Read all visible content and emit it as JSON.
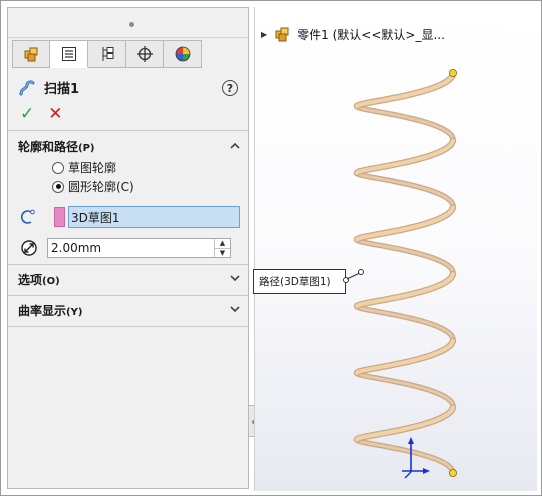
{
  "property_manager": {
    "tabs": [
      {
        "icon": "feature-manager-icon"
      },
      {
        "icon": "property-manager-icon"
      },
      {
        "icon": "configuration-manager-icon"
      },
      {
        "icon": "dimxpert-manager-icon"
      },
      {
        "icon": "display-manager-icon"
      }
    ],
    "active_tab": 1,
    "feature_title": "扫描1",
    "help_label": "?",
    "ok_symbol": "✓",
    "cancel_symbol": "✕",
    "sections": {
      "profile_path": {
        "title": "轮廓和路径",
        "suffix": "(P)",
        "expanded": true,
        "options": [
          {
            "label": "草图轮廓",
            "checked": false
          },
          {
            "label": "圆形轮廓(C)",
            "checked": true
          }
        ],
        "path_value": "3D草图1",
        "diameter_value": "2.00mm"
      },
      "options": {
        "title": "选项",
        "suffix": "(O)",
        "expanded": false
      },
      "curvature": {
        "title": "曲率显示",
        "suffix": "(Y)",
        "expanded": false
      }
    }
  },
  "graphics": {
    "tree_item": "零件1  (默认<<默认>_显...",
    "callout_label": "路径(3D草图1)",
    "colors": {
      "helix": "#f1d2a8",
      "helix_shade": "#c9a887",
      "endpoint": "#f5d23a"
    }
  }
}
